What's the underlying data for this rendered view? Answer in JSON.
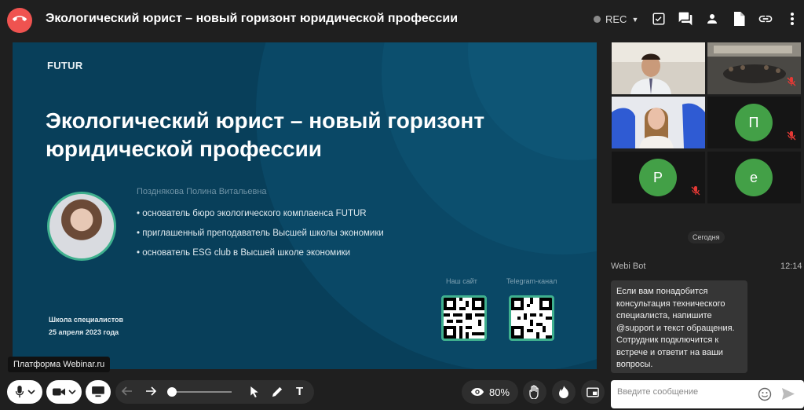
{
  "window": {
    "title": "Экологический юрист – новый горизонт юридической профессии",
    "rec_label": "REC"
  },
  "slide": {
    "brand": "FUTUR",
    "title": "Экологический юрист – новый горизонт юридической профессии",
    "speaker_name": "Позднякова Полина Витальевна",
    "bullets": [
      "• основатель бюро экологического комплаенса FUTUR",
      "• приглашенный преподаватель Высшей школы экономики",
      "• основатель ESG club в Высшей школе экономики"
    ],
    "qr_site_label": "Наш сайт",
    "qr_telegram_label": "Telegram-канал",
    "school_line1": "Школа специалистов",
    "school_line2": "25 апреля 2023 года"
  },
  "tooltip": "Платформа Webinar.ru",
  "toolbar": {
    "zoom": "80%"
  },
  "participants": [
    {
      "letter": ""
    },
    {
      "letter": ""
    },
    {
      "letter": ""
    },
    {
      "letter": "П"
    },
    {
      "letter": "P"
    },
    {
      "letter": "e"
    }
  ],
  "chat": {
    "date_divider": "Сегодня",
    "bot_name": "Webi Bot",
    "bot_time": "12:14",
    "bot_message": "Если вам понадобится консультация технического специалиста, напишите @support и текст обращения. Сотрудник подключится к встрече и ответит на ваши вопросы.",
    "input_placeholder": "Введите сообщение"
  },
  "colors": {
    "hangup": "#ef5350",
    "slide_bg": "#083f5a",
    "accent_green": "#3fb08e",
    "avatar_green": "#43a047"
  }
}
